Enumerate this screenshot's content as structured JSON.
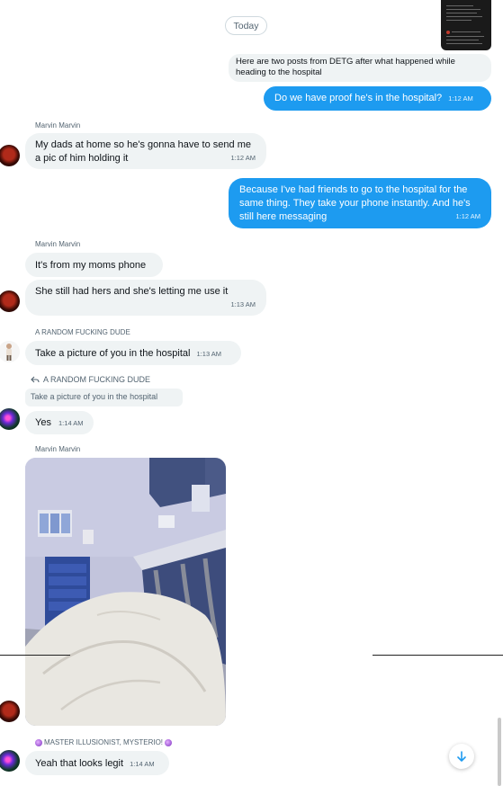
{
  "date_divider": "Today",
  "messages": {
    "m1": {
      "text": "Here are two posts from DETG after what happened while heading to the hospital"
    },
    "m2": {
      "text": "Do we have proof he's in the hospital?",
      "time": "1:12 AM"
    },
    "m3": {
      "sender": "Marvin Marvin",
      "text": "My dads at home so he's gonna have to send me a pic of him holding it",
      "time": "1:12 AM"
    },
    "m4": {
      "text": "Because I've had friends to go to the hospital for the same thing. They take your phone instantly. And he's still here messaging",
      "time": "1:12 AM"
    },
    "m5": {
      "sender": "Marvin Marvin",
      "text": "It's from my moms phone"
    },
    "m6": {
      "text": "She still had hers and she's letting me use it",
      "time": "1:13 AM"
    },
    "m7": {
      "sender": "A RANDOM FUCKING DUDE",
      "text": "Take a picture of you in the hospital",
      "time": "1:13 AM"
    },
    "m8": {
      "reply_to": "A RANDOM FUCKING DUDE",
      "quoted": "Take a picture of you in the hospital",
      "text": "Yes",
      "time": "1:14 AM"
    },
    "m9": {
      "sender": "Marvin Marvin"
    },
    "m10": {
      "sender": "MASTER ILLUSIONIST, MYSTERIO!",
      "text": "Yeah that looks legit",
      "time": "1:14 AM"
    }
  },
  "icons": {
    "reply": "reply-arrow-icon",
    "scroll_down": "arrow-down-icon",
    "emoji": "crystal-ball-icon"
  },
  "colors": {
    "accent": "#1d9bf0",
    "incoming_bubble": "#eff3f4",
    "secondary_text": "#536471"
  }
}
